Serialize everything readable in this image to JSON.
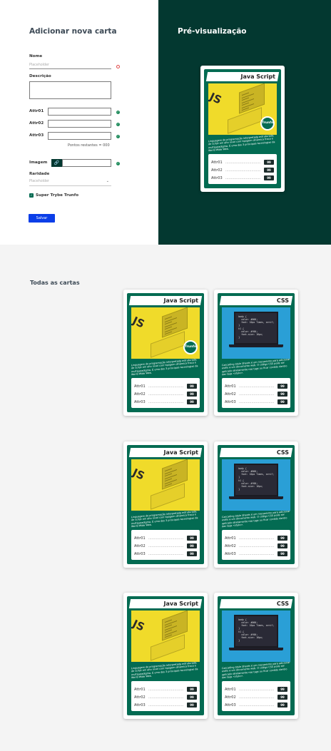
{
  "form": {
    "title": "Adicionar nova carta",
    "name_label": "Nome",
    "name_placeholder": "Placeholder",
    "description_label": "Descrição",
    "attr1_label": "Attr01",
    "attr2_label": "Attr02",
    "attr3_label": "Attr03",
    "remaining": "Pontos restantes = 000",
    "image_label": "Imagem",
    "image_icon": "link-icon",
    "rarity_label": "Raridade",
    "rarity_placeholder": "Placeholder",
    "super_trunfo_label": "Super Trybe Trunfo",
    "save_label": "Salvar"
  },
  "preview": {
    "title": "Pré-visualização",
    "card": {
      "name": "Java Script",
      "image": "js",
      "trunfo": true,
      "trunfo_label": "Trunfo",
      "description": "Linguagem de programação interpretada estruturada, de script em alto nível com tipagem dinâmica fraca e multiparadigma. É uma das 3 principais tecnologias da World Wide Web.",
      "attrs": [
        {
          "name": "Attr01",
          "value": "99"
        },
        {
          "name": "Attr02",
          "value": "99"
        },
        {
          "name": "Attr03",
          "value": "99"
        }
      ]
    }
  },
  "all_cards": {
    "title": "Todas as cartas",
    "cards": [
      {
        "name": "Java Script",
        "image": "js",
        "trunfo": true,
        "trunfo_label": "Trunfo",
        "description": "Linguagem de programação interpretada estruturada, de script em alto nível com tipagem dinâmica fraca e multiparadigma. É uma das 3 principais tecnologias da World Wide Web.",
        "attrs": [
          {
            "name": "Attr01",
            "value": "99"
          },
          {
            "name": "Attr02",
            "value": "99"
          },
          {
            "name": "Attr03",
            "value": "99"
          }
        ]
      },
      {
        "name": "CSS",
        "image": "css",
        "trunfo": false,
        "description": "Cascading Style Sheets é um mecanismo para adicionar estilo a um documento web. O código CSS pode ser aplicado diretamente nas tags ou ficar contido dentro das tags <style>.",
        "attrs": [
          {
            "name": "Attr01",
            "value": "99"
          },
          {
            "name": "Attr02",
            "value": "99"
          },
          {
            "name": "Attr03",
            "value": "99"
          }
        ]
      },
      {
        "name": "Java Script",
        "image": "js",
        "trunfo": false,
        "description": "Linguagem de programação interpretada estruturada, de script em alto nível com tipagem dinâmica fraca e multiparadigma. É uma das 3 principais tecnologias da World Wide Web.",
        "attrs": [
          {
            "name": "Attr01",
            "value": "99"
          },
          {
            "name": "Attr02",
            "value": "99"
          },
          {
            "name": "Attr03",
            "value": "99"
          }
        ]
      },
      {
        "name": "CSS",
        "image": "css",
        "trunfo": false,
        "description": "Cascading Style Sheets é um mecanismo para adicionar estilo a um documento web. O código CSS pode ser aplicado diretamente nas tags ou ficar contido dentro das tags <style>.",
        "attrs": [
          {
            "name": "Attr01",
            "value": "99"
          },
          {
            "name": "Attr02",
            "value": "99"
          },
          {
            "name": "Attr03",
            "value": "99"
          }
        ]
      },
      {
        "name": "Java Script",
        "image": "js",
        "trunfo": false,
        "description": "Linguagem de programação interpretada estruturada, de script em alto nível com tipagem dinâmica fraca e multiparadigma. É uma das 3 principais tecnologias da World Wide Web.",
        "attrs": [
          {
            "name": "Attr01",
            "value": "99"
          },
          {
            "name": "Attr02",
            "value": "99"
          },
          {
            "name": "Attr03",
            "value": "99"
          }
        ]
      },
      {
        "name": "CSS",
        "image": "css",
        "trunfo": false,
        "description": "Cascading Style Sheets é um mecanismo para adicionar estilo a um documento web. O código CSS pode ser aplicado diretamente nas tags ou ficar contido dentro das tags <style>.",
        "attrs": [
          {
            "name": "Attr01",
            "value": "99"
          },
          {
            "name": "Attr02",
            "value": "99"
          },
          {
            "name": "Attr03",
            "value": "99"
          }
        ]
      }
    ],
    "css_code": "body {\n  color: #000;\n  font: 10px Times, serif;\n}\nh1 {\n  color: #f00;\n  font-size: 16px;\n}"
  },
  "colors": {
    "primary_dark": "#033830",
    "card_green": "#036b52",
    "save_button": "#0b3ee8",
    "js_yellow": "#f0db2a",
    "css_blue": "#2a9fd6"
  }
}
